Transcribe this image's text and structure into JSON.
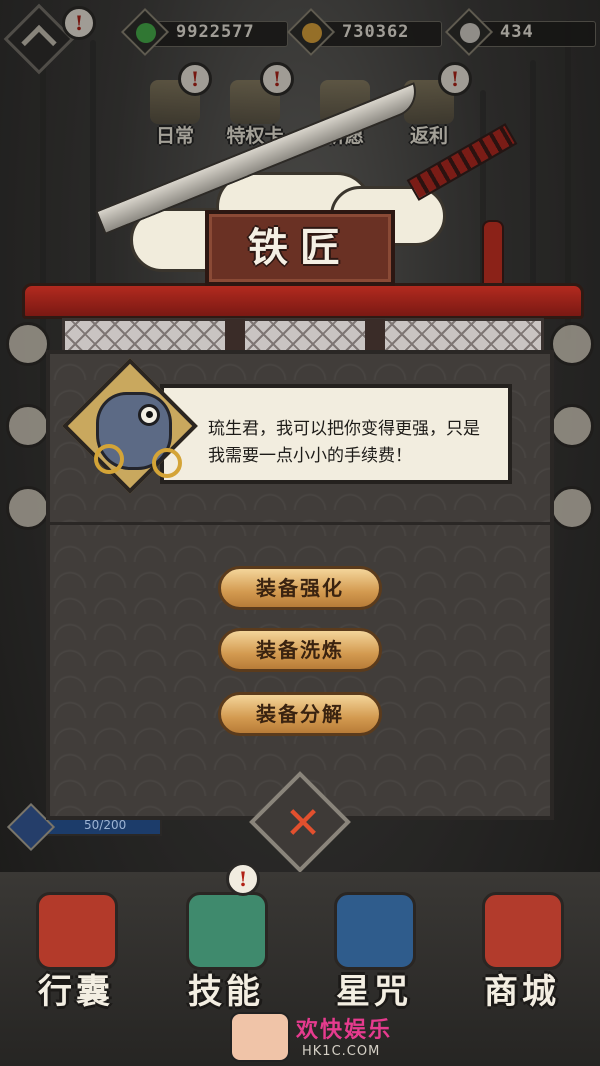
{
  "resources": [
    {
      "name": "jade",
      "icon": "jade-icon",
      "value": "9922577",
      "color": "#46b24a"
    },
    {
      "name": "coin",
      "icon": "coin-icon",
      "value": "730362",
      "color": "#e0a63a"
    },
    {
      "name": "yinyang",
      "icon": "yinyang-icon",
      "value": "434",
      "color": "#d9d5cc"
    }
  ],
  "top_features": [
    {
      "label": "日常",
      "icon": "scroll-icon"
    },
    {
      "label": "特权卡",
      "icon": "card-icon"
    },
    {
      "label": "祈愿",
      "icon": "shrine-icon"
    },
    {
      "label": "返利",
      "icon": "treasure-chest-icon"
    }
  ],
  "dialog": {
    "title": "铁匠",
    "npc_text": "琉生君，我可以把你变得更强，只是我需要一点小小的手续费！",
    "buttons": [
      {
        "label": "装备强化"
      },
      {
        "label": "装备洗炼"
      },
      {
        "label": "装备分解"
      }
    ],
    "close_symbol": "✕"
  },
  "energy": {
    "text": "50/200"
  },
  "bottom_nav": [
    {
      "label": "行囊",
      "icon": "bag-icon",
      "color": "#b33a2a"
    },
    {
      "label": "技能",
      "icon": "sickle-chain-icon",
      "color": "#3f8a6d"
    },
    {
      "label": "星咒",
      "icon": "star-scroll-icon",
      "color": "#2f5c8c"
    },
    {
      "label": "商城",
      "icon": "shop-icon",
      "color": "#b23b2c"
    }
  ],
  "watermark": {
    "brand": "欢快娱乐",
    "url": "HK1C.COM"
  },
  "colors": {
    "accent": "#d39a50",
    "roof": "#b22a1f",
    "alert": "#b12015"
  }
}
